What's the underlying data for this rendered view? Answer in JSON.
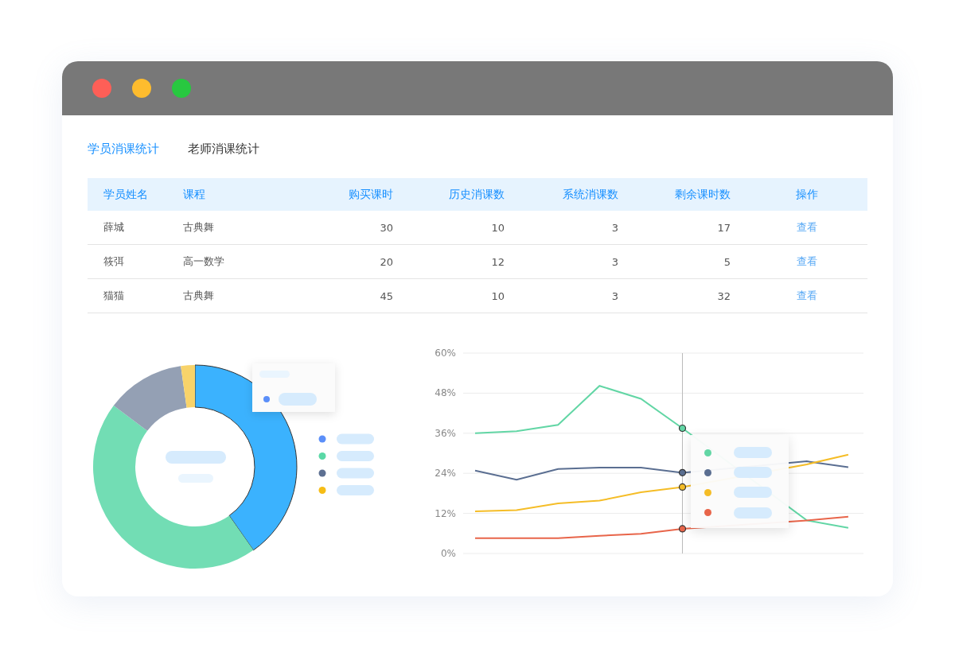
{
  "tabs": [
    {
      "label": "学员消课统计",
      "selected": true
    },
    {
      "label": "老师消课统计",
      "selected": false
    }
  ],
  "table": {
    "columns": [
      "学员姓名",
      "课程",
      "购买课时",
      "历史消课数",
      "系统消课数",
      "剩余课时数",
      "操作"
    ],
    "rows": [
      [
        "薛城",
        "古典舞",
        "30",
        "10",
        "3",
        "17",
        "查看"
      ],
      [
        "筱弭",
        "高一数学",
        "20",
        "12",
        "3",
        "5",
        "查看"
      ],
      [
        "猫猫",
        "古典舞",
        "45",
        "10",
        "3",
        "32",
        "查看"
      ]
    ]
  },
  "line_chart": {
    "chart_data": {
      "type": "line",
      "grid": true,
      "ylim": [
        0,
        60
      ],
      "yticks": [
        {
          "value": 0,
          "label": "0%"
        },
        {
          "value": 12,
          "label": "12%"
        },
        {
          "value": 24,
          "label": "24%"
        },
        {
          "value": 36,
          "label": "36%"
        },
        {
          "value": 48,
          "label": "48%"
        },
        {
          "value": 60,
          "label": "60%"
        }
      ],
      "series": [
        {
          "color": "#62d6a5",
          "values": [
            36,
            36.6,
            38.5,
            50.2,
            46.3,
            37.5,
            null,
            null,
            9.9,
            7.7
          ]
        },
        {
          "color": "#5a6e91",
          "values": [
            24.8,
            22.1,
            25.3,
            25.7,
            25.7,
            24.2,
            null,
            null,
            27.6,
            25.8
          ]
        },
        {
          "color": "#f5bd27",
          "values": [
            12.6,
            13,
            15,
            15.8,
            18.3,
            19.9,
            null,
            null,
            26.7,
            29.6
          ]
        },
        {
          "color": "#e8654a",
          "values": [
            4.6,
            4.6,
            4.6,
            5.3,
            5.9,
            7.4,
            null,
            null,
            9.9,
            11
          ]
        }
      ]
    }
  }
}
